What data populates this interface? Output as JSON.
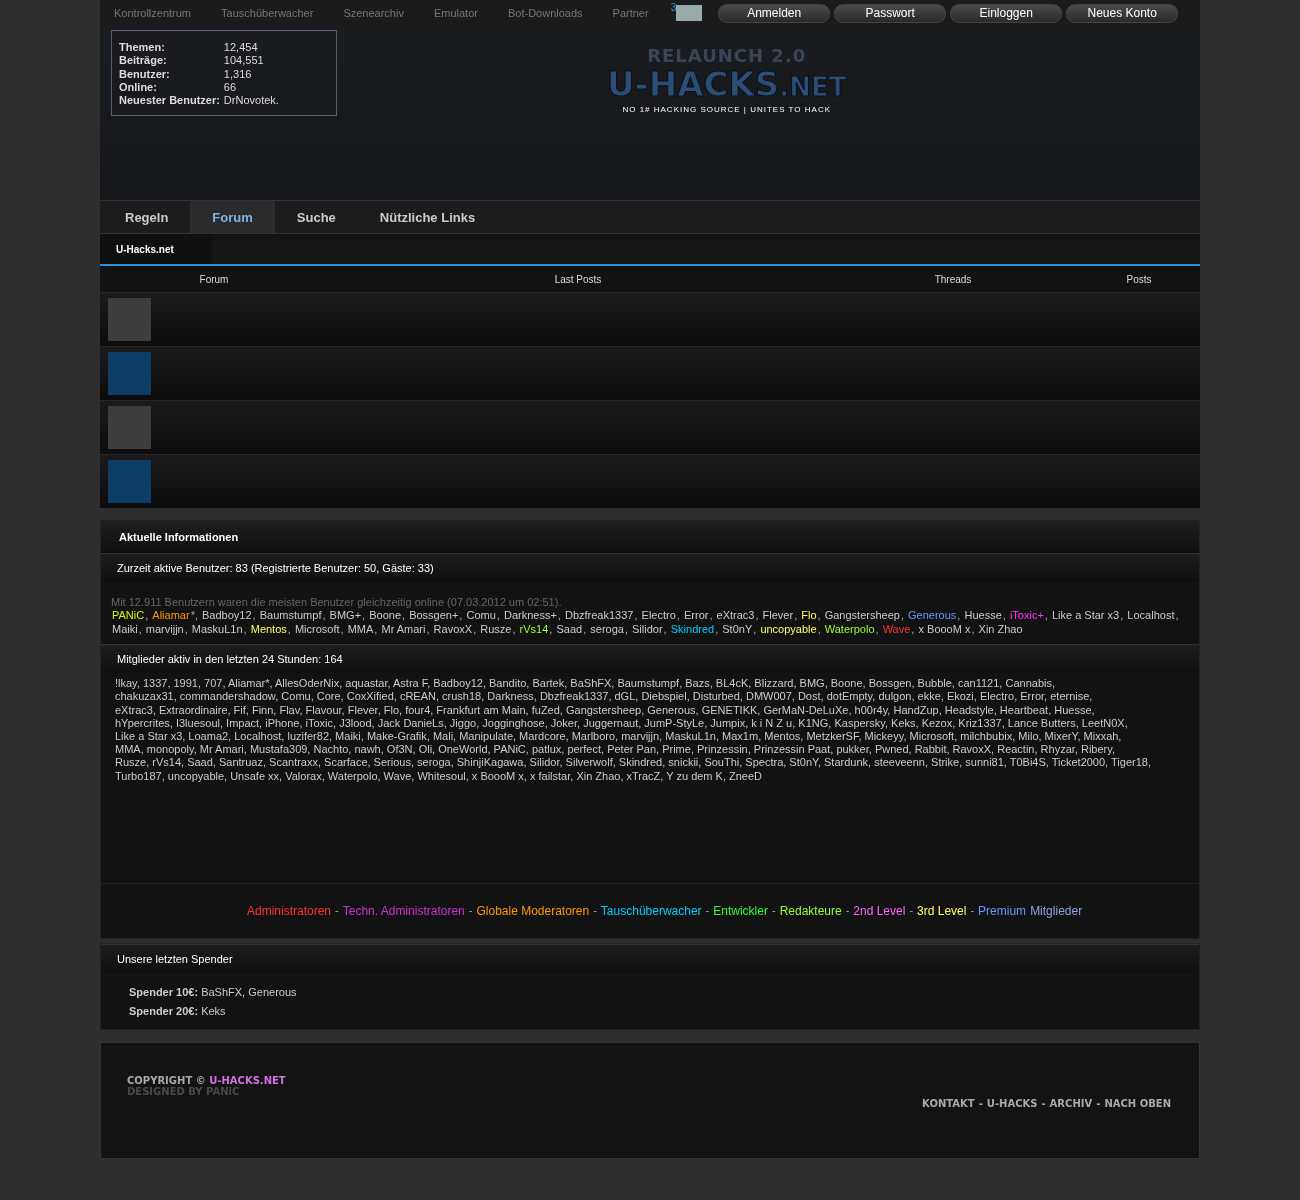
{
  "top_nav": {
    "links": [
      "Kontrollzentrum",
      "Tauschüberwacher",
      "Szenearchiv",
      "Emulator",
      "Bot-Downloads",
      "Partner"
    ],
    "badge": "3",
    "buttons": [
      "Anmelden",
      "Passwort",
      "Einloggen",
      "Neues Konto"
    ]
  },
  "stats": [
    {
      "label": "Themen:",
      "value": "12,454"
    },
    {
      "label": "Beiträge:",
      "value": "104,551"
    },
    {
      "label": "Benutzer:",
      "value": "1,316"
    },
    {
      "label": "Online:",
      "value": "66"
    },
    {
      "label": "Neuester Benutzer:",
      "value": "DrNovotek."
    }
  ],
  "logo": {
    "overline": "RELAUNCH 2.0",
    "title": "U-HACKS",
    "suffix": ".NET",
    "tagline": "NO 1# HACKING SOURCE | UNITES TO HACK"
  },
  "tabs": [
    {
      "label": "Regeln",
      "selected": false
    },
    {
      "label": "Forum",
      "selected": true
    },
    {
      "label": "Suche",
      "selected": false
    },
    {
      "label": "Nützliche Links",
      "selected": false
    }
  ],
  "breadcrumb": "U-Hacks.net",
  "forum_table": {
    "columns": [
      "Forum",
      "Last Posts",
      "Threads",
      "Posts"
    ],
    "rows": [
      {
        "color": "#3d3d3d"
      },
      {
        "color": "#0d3d66"
      },
      {
        "color": "#3d3d3d"
      },
      {
        "color": "#0d3d66"
      }
    ]
  },
  "info": {
    "title": "Aktuelle Informationen",
    "active_heading": "Zurzeit aktive Benutzer: 83 (Registrierte Benutzer: 50, Gäste: 33)",
    "record": "Mit 12.911 Benutzern waren die meisten Benutzer gleichzeitig online (07.03.2012 um 02:51).",
    "online_users": [
      {
        "name": "PANiC",
        "color": "#ccff00"
      },
      {
        "name": "Aliamar",
        "color": "#ff9900",
        "suffix": "*"
      },
      {
        "name": "Badboy12"
      },
      {
        "name": "Baumstumpf"
      },
      {
        "name": "BMG+"
      },
      {
        "name": "Boone"
      },
      {
        "name": "Bossgen+"
      },
      {
        "name": "Comu"
      },
      {
        "name": "Darkness+"
      },
      {
        "name": "Dbzfreak1337"
      },
      {
        "name": "Electro"
      },
      {
        "name": "Error"
      },
      {
        "name": "eXtrac3"
      },
      {
        "name": "Flever"
      },
      {
        "name": "Flo",
        "color": "#ffff66"
      },
      {
        "name": "Gangstersheep"
      },
      {
        "name": "Generous",
        "color": "#6699ff"
      },
      {
        "name": "Huesse"
      },
      {
        "name": "iToxic+",
        "color": "#ff33ff"
      },
      {
        "name": "Like a Star x3"
      },
      {
        "name": "Localhost"
      },
      {
        "name": "Maiki"
      },
      {
        "name": "marvijjn"
      },
      {
        "name": "MaskuL1n"
      },
      {
        "name": "Mentos",
        "color": "#ffff66"
      },
      {
        "name": "Microsoft"
      },
      {
        "name": "MMA"
      },
      {
        "name": "Mr Amari"
      },
      {
        "name": "RavoxX"
      },
      {
        "name": "Rusze"
      },
      {
        "name": "rVs14",
        "color": "#99ff33"
      },
      {
        "name": "Saad"
      },
      {
        "name": "seroga"
      },
      {
        "name": "Silidor"
      },
      {
        "name": "Skindred",
        "color": "#00ccff"
      },
      {
        "name": "St0nY"
      },
      {
        "name": "uncopyable",
        "color": "#ffff66"
      },
      {
        "name": "Waterpolo",
        "color": "#99ff33"
      },
      {
        "name": "Wave",
        "color": "#ff3333"
      },
      {
        "name": "x BoooM x"
      },
      {
        "name": "Xin Zhao"
      }
    ],
    "user_separator": ",",
    "day_heading": "Mitglieder aktiv in den letzten 24 Stunden: 164",
    "day_lines": [
      "!lkay, 1337, 1991, 707, Aliamar*, AllesOderNix, aquastar, Astra F, Badboy12, Bandito, Bartek, BaShFX, Baumstumpf, Bazs, BL4cK, Blizzard, BMG, Boone, Bossgen, Bubble, can1121, Cannabis,",
      "chakuzax31, commandershadow, Comu, Core, CoxXified, cREAN, crush18, Darkness, Dbzfreak1337, dGL, Diebspiel, Disturbed, DMW007, Dost, dotEmpty, dulgon, ekke, Ekozi, Electro, Error, eternise,",
      "eXtrac3, Extraordinaire, Fif, Finn, Flav, Flavour, Flever, Flo, four4, Frankfurt am Main, fuZed, Gangstersheep, Generous, GENETIKK, GerMaN-DeLuXe, h00r4y, HandZup, Headstyle, Heartbeat, Huesse,",
      "hYpercrites, I3luesoul, Impact, iPhone, iToxic, J3lood, Jack DanieLs, Jiggo, Jogginghose, Joker, Juggernaut, JumP-StyLe, Jumpix, k i N Z u, K1NG, Kaspersky, Keks, Kezox, Kriz1337, Lance Butters, LeetN0X,",
      "Like a Star x3, Loama2, Localhost, luzifer82, Maiki, Make-Grafik, Mali, Manipulate, Mardcore, Marlboro, marvijjn, MaskuL1n, Max1m, Mentos, MetzkerSF, Mickeyy, Microsoft, milchbubix, Milo, MixerY, Mixxah,",
      "MMA, monopoly, Mr Amari, Mustafa309, Nachto, nawh, Of3N, Oli, OneWorld, PANiC, patlux, perfect, Peter Pan, Prime, Prinzessin, Prinzessin Paat, pukker, Pwned, Rabbit, RavoxX, Reactin, Rhyzar, Ribery,",
      "Rusze, rVs14, Saad, Santruaz, Scantraxx, Scarface, Serious, seroga, ShinjiKagawa, Silidor, Silverwolf, Skindred, snickii, SouThi, Spectra, St0nY, Stardunk, steeveenn, Strike, sunni81, T0Bi4S, Ticket2000, Tiger18,",
      "Turbo187, uncopyable, Unsafe xx, Valorax, Waterpolo, Wave, Whitesoul, x BoooM x, x failstar, Xin Zhao, xTracZ, Y zu dem K, ZneeD"
    ],
    "legend": [
      {
        "label": "Administratoren",
        "color": "#ff3333"
      },
      {
        "label": "Techn. Administratoren",
        "color": "#cc33cc"
      },
      {
        "label": "Globale Moderatoren",
        "color": "#ff9900"
      },
      {
        "label": "Tauschüberwacher",
        "color": "#00ccff"
      },
      {
        "label": "Entwickler",
        "color": "#33ff33"
      },
      {
        "label": "Redakteure",
        "color": "#99ff33"
      },
      {
        "label": "2nd Level",
        "color": "#ff66ff"
      },
      {
        "label": "3rd Level",
        "color": "#ffff66"
      },
      {
        "label": "Premium",
        "color": "#6699ff",
        "suffix": "Mitglieder"
      }
    ],
    "legend_separator": "-"
  },
  "donors": {
    "title": "Unsere letzten Spender",
    "entries": [
      {
        "label": "Spender 10€:",
        "names": "BaShFX, Generous"
      },
      {
        "label": "Spender 20€:",
        "names": "Keks"
      }
    ]
  },
  "footer": {
    "copyright": "COPYRIGHT ©",
    "site": "U-HACKS.NET",
    "designer": "DESIGNED BY PANiC",
    "links": [
      "KONTAKT",
      "U-HACKS",
      "ARCHIV",
      "NACH OBEN"
    ],
    "link_separator": "-"
  }
}
